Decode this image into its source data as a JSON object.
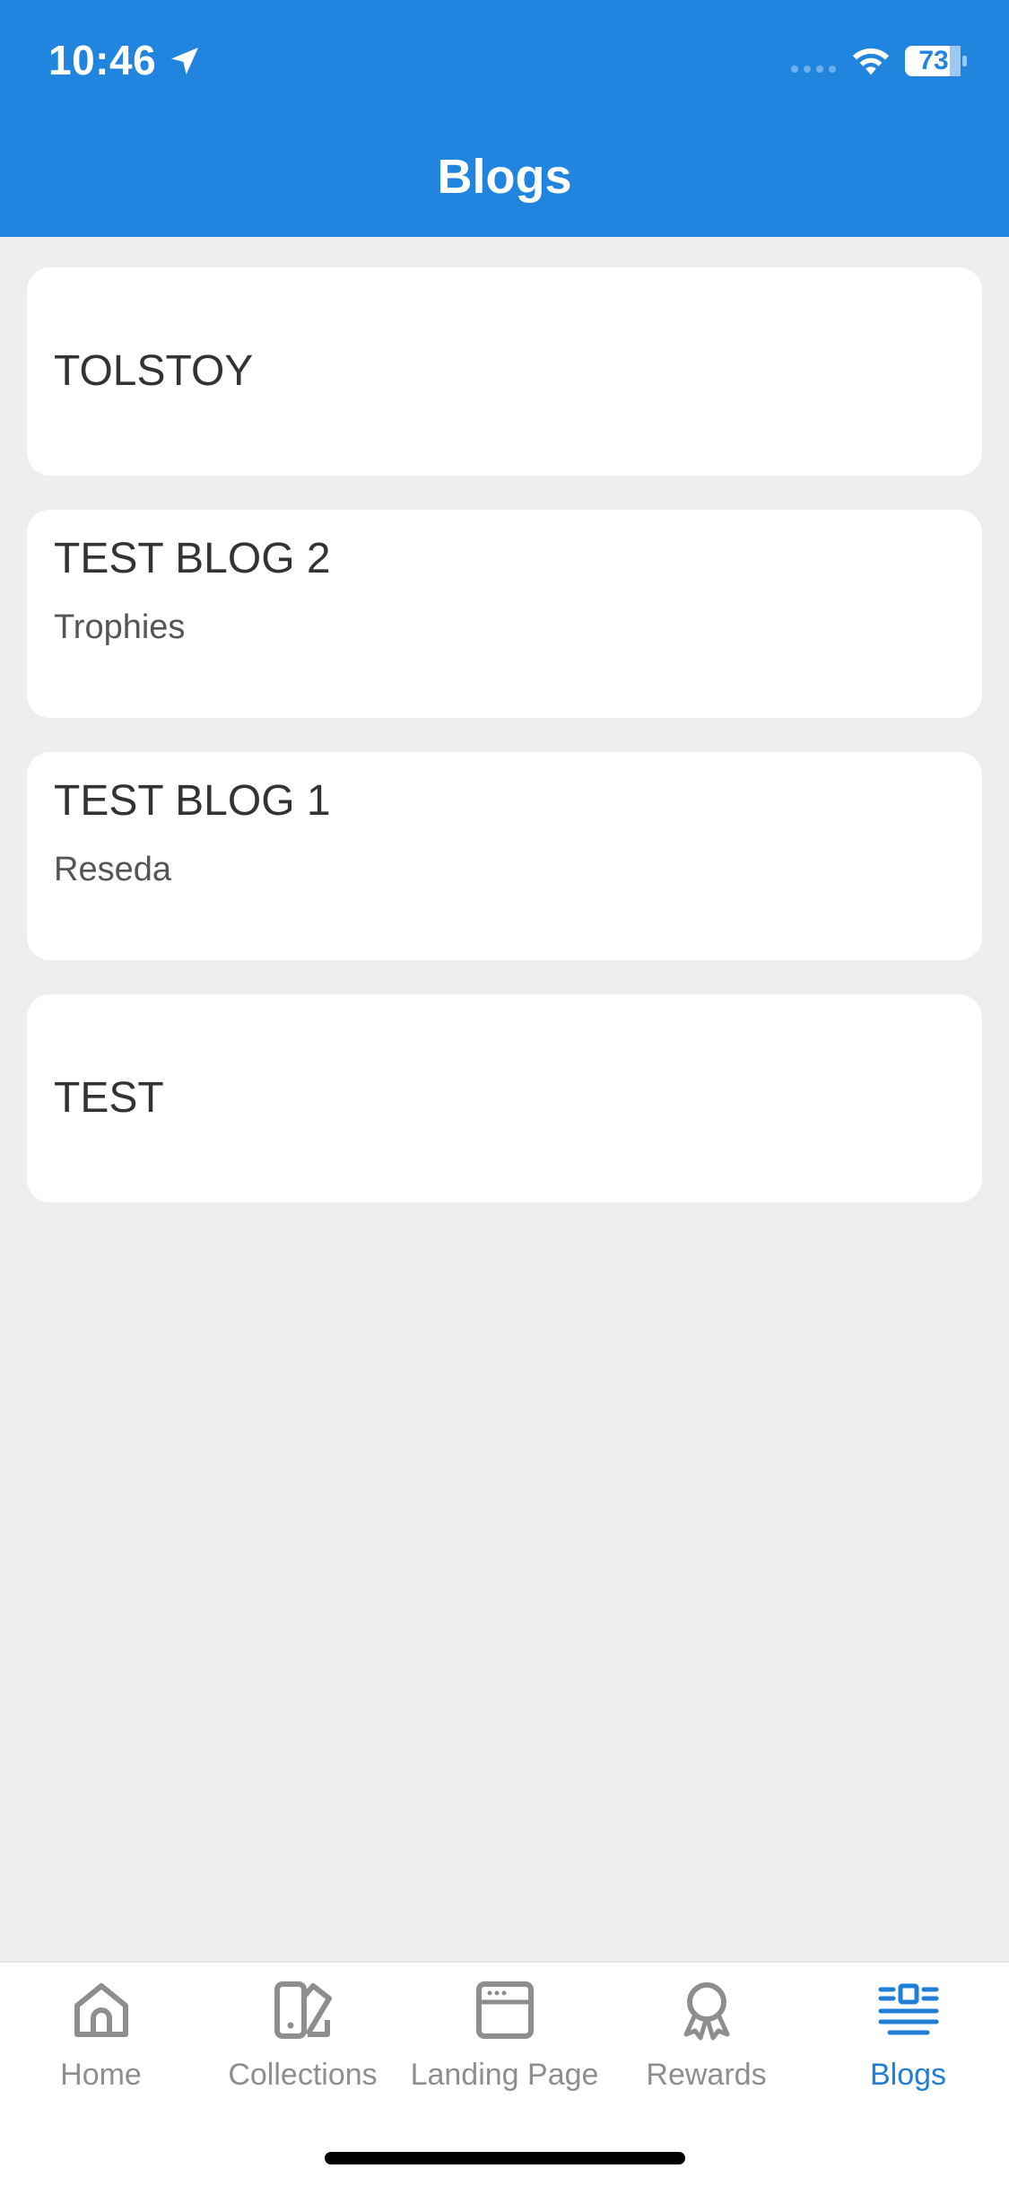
{
  "status_bar": {
    "time": "10:46",
    "battery": "73"
  },
  "header": {
    "title": "Blogs"
  },
  "blogs": [
    {
      "title": "TOLSTOY",
      "subtitle": ""
    },
    {
      "title": "TEST BLOG 2",
      "subtitle": "Trophies"
    },
    {
      "title": "TEST BLOG 1",
      "subtitle": "Reseda"
    },
    {
      "title": "TEST",
      "subtitle": ""
    }
  ],
  "tabbar": {
    "items": [
      {
        "label": "Home",
        "icon": "home-icon"
      },
      {
        "label": "Collections",
        "icon": "collections-icon"
      },
      {
        "label": "Landing Page",
        "icon": "landing-page-icon"
      },
      {
        "label": "Rewards",
        "icon": "rewards-icon"
      },
      {
        "label": "Blogs",
        "icon": "blogs-icon",
        "active": true
      }
    ]
  },
  "colors": {
    "header": "#2185df",
    "active_tab": "#1f7fd6",
    "inactive_tab": "#8e8e8e",
    "background": "#eeeeee"
  }
}
